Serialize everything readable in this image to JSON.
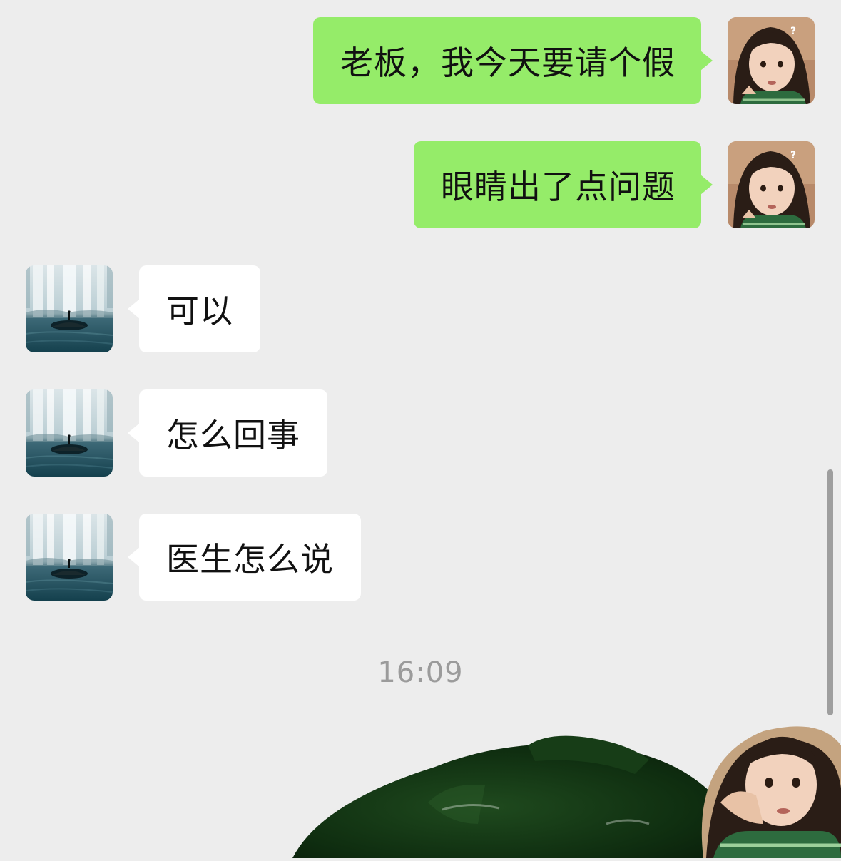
{
  "messages": [
    {
      "direction": "outgoing",
      "text": "老板，我今天要请个假",
      "avatar_icon": "child-avatar-icon"
    },
    {
      "direction": "outgoing",
      "text": "眼睛出了点问题",
      "avatar_icon": "child-avatar-icon"
    },
    {
      "direction": "incoming",
      "text": "可以",
      "avatar_icon": "waterfall-avatar-icon"
    },
    {
      "direction": "incoming",
      "text": "怎么回事",
      "avatar_icon": "waterfall-avatar-icon"
    },
    {
      "direction": "incoming",
      "text": "医生怎么说",
      "avatar_icon": "waterfall-avatar-icon"
    }
  ],
  "timestamp": "16:09",
  "colors": {
    "background": "#ededed",
    "outgoing_bubble": "#95ec69",
    "incoming_bubble": "#ffffff",
    "timestamp_text": "#9b9b9b"
  }
}
